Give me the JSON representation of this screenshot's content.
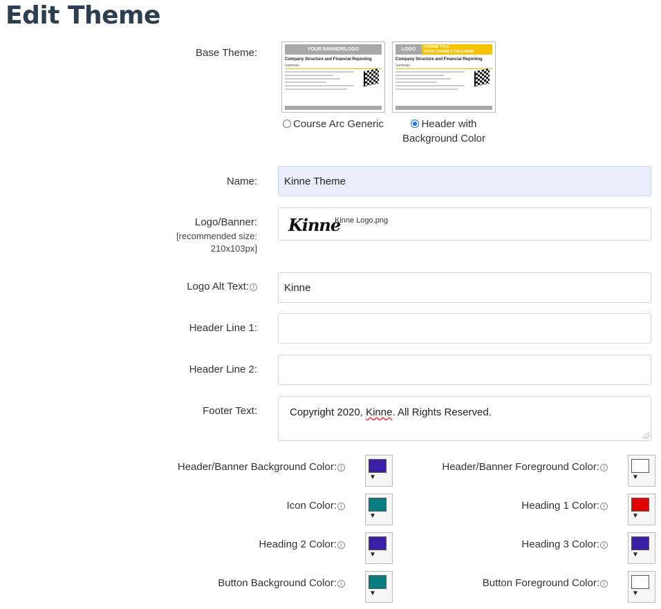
{
  "page_title": "Edit Theme",
  "base_theme": {
    "label": "Base Theme:",
    "options": [
      {
        "label": "Course Arc Generic",
        "checked": false,
        "thumb_banner": "YOUR BANNER/LOGO",
        "thumb_title": "Company Structure and Financial Reporting",
        "thumb_sub": "Summary"
      },
      {
        "label_line1": "Header with",
        "label_line2": "Background Color",
        "checked": true,
        "thumb_logo": "LOGO",
        "thumb_header_a": "COURSE TITLE",
        "thumb_header_b": "YOUR COURSE'S TITLE HERE",
        "thumb_title": "Company Structure and Financial Reporting",
        "thumb_sub": "Summary"
      }
    ]
  },
  "name": {
    "label": "Name:",
    "value": "Kinne Theme"
  },
  "logo": {
    "label": "Logo/Banner:",
    "hint_line1": "[recommended size:",
    "hint_line2": "210x103px]",
    "logo_text": "Kinne",
    "filename": "Kinne Logo.png"
  },
  "logo_alt": {
    "label": "Logo Alt Text:",
    "value": "Kinne"
  },
  "header1": {
    "label": "Header Line 1:",
    "value": ""
  },
  "header2": {
    "label": "Header Line 2:",
    "value": ""
  },
  "footer": {
    "label": "Footer Text:",
    "value_pre": "Copyright 2020, ",
    "value_word": "Kinne",
    "value_post": ". All Rights Reserved."
  },
  "colors": {
    "header_bg": {
      "label": "Header/Banner Background Color:",
      "color": "#3d1ea8"
    },
    "header_fg": {
      "label": "Header/Banner Foreground Color:",
      "color": "#ffffff"
    },
    "icon": {
      "label": "Icon Color:",
      "color": "#0a7d80"
    },
    "h1": {
      "label": "Heading 1 Color:",
      "color": "#e00000"
    },
    "h2": {
      "label": "Heading 2 Color:",
      "color": "#3d1ea8"
    },
    "h3": {
      "label": "Heading 3 Color:",
      "color": "#3d1ea8"
    },
    "btn_bg": {
      "label": "Button Background Color:",
      "color": "#0a7d80"
    },
    "btn_fg": {
      "label": "Button Foreground Color:",
      "color": "#ffffff"
    }
  },
  "icons": {
    "info": "info-icon",
    "dropdown": "caret-down-icon"
  }
}
